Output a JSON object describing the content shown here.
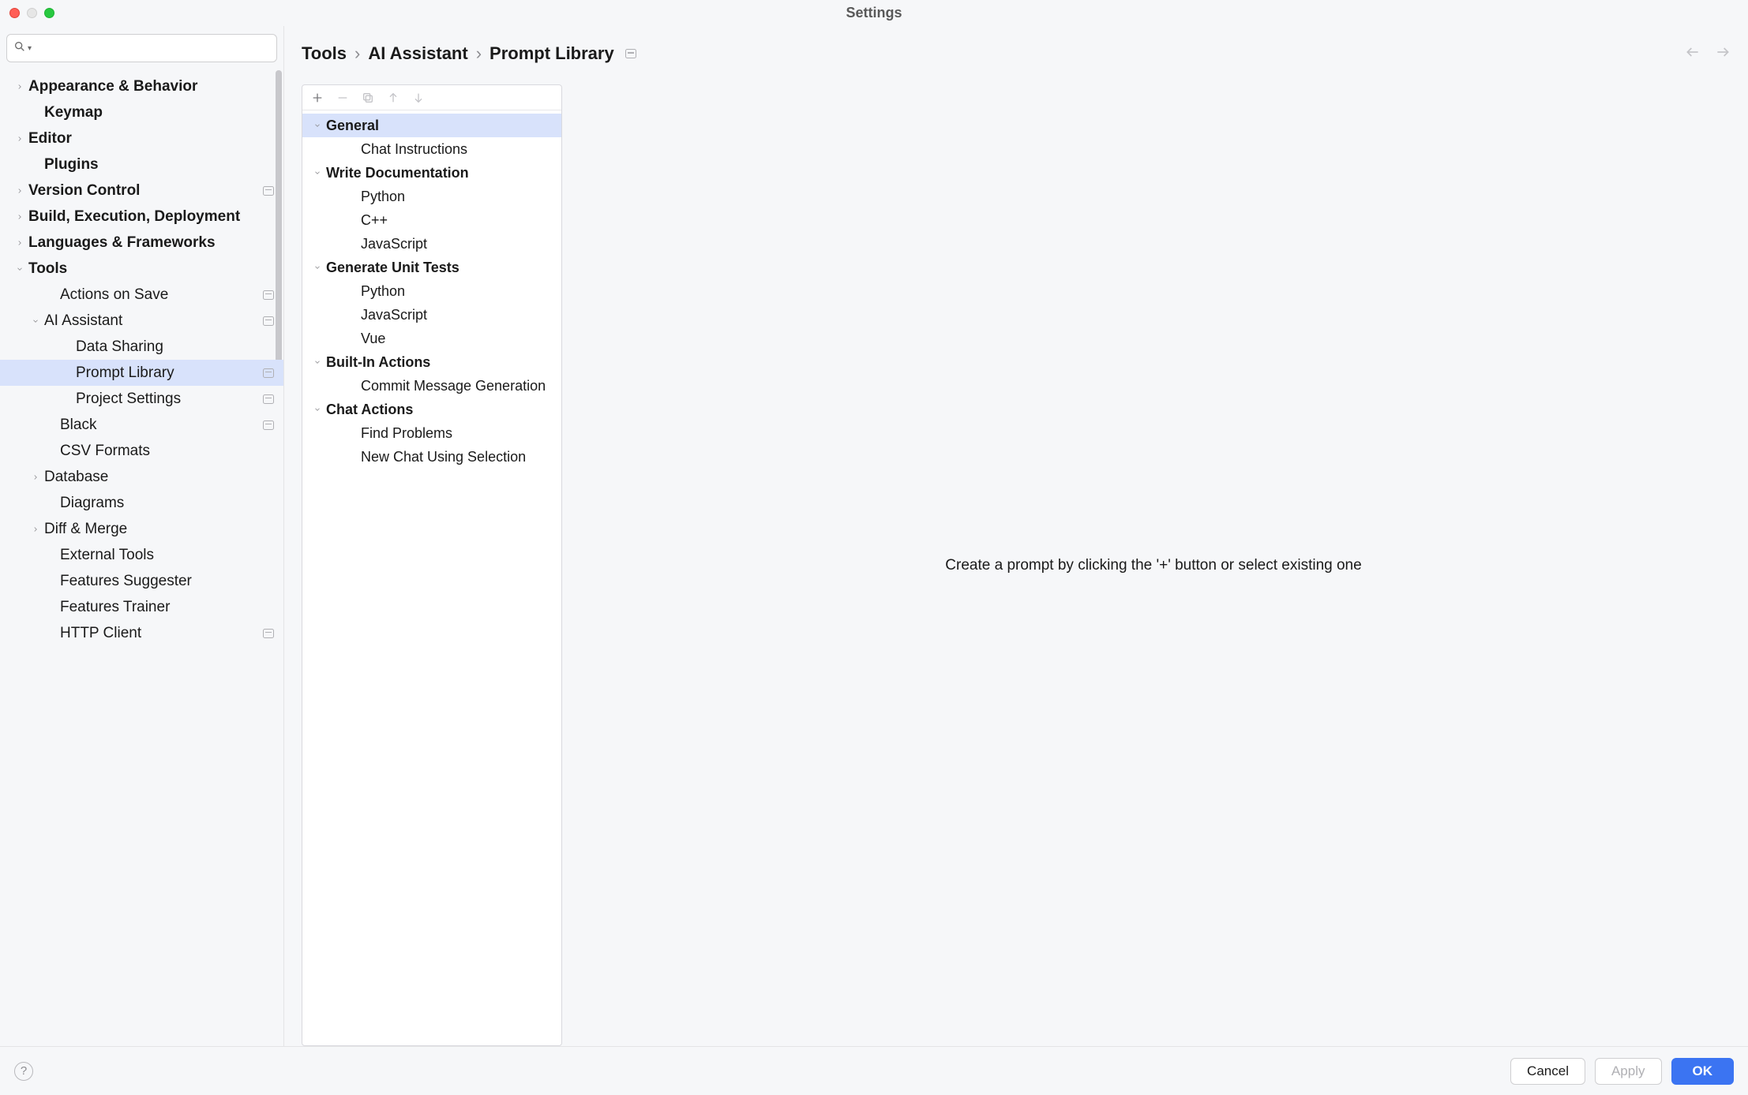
{
  "window": {
    "title": "Settings"
  },
  "search": {
    "placeholder": ""
  },
  "sidebar": {
    "items": [
      {
        "label": "Appearance & Behavior",
        "bold": true,
        "arrow": "right",
        "indent": 18,
        "badge": false
      },
      {
        "label": "Keymap",
        "bold": true,
        "arrow": "none",
        "indent": 38,
        "badge": false
      },
      {
        "label": "Editor",
        "bold": true,
        "arrow": "right",
        "indent": 18,
        "badge": false
      },
      {
        "label": "Plugins",
        "bold": true,
        "arrow": "none",
        "indent": 38,
        "badge": false
      },
      {
        "label": "Version Control",
        "bold": true,
        "arrow": "right",
        "indent": 18,
        "badge": true
      },
      {
        "label": "Build, Execution, Deployment",
        "bold": true,
        "arrow": "right",
        "indent": 18,
        "badge": false
      },
      {
        "label": "Languages & Frameworks",
        "bold": true,
        "arrow": "right",
        "indent": 18,
        "badge": false
      },
      {
        "label": "Tools",
        "bold": true,
        "arrow": "down",
        "indent": 18,
        "badge": false
      },
      {
        "label": "Actions on Save",
        "bold": false,
        "arrow": "none",
        "indent": 58,
        "badge": true
      },
      {
        "label": "AI Assistant",
        "bold": false,
        "arrow": "down",
        "indent": 38,
        "badge": true
      },
      {
        "label": "Data Sharing",
        "bold": false,
        "arrow": "none",
        "indent": 78,
        "badge": false
      },
      {
        "label": "Prompt Library",
        "bold": false,
        "arrow": "none",
        "indent": 78,
        "badge": true,
        "selected": true
      },
      {
        "label": "Project Settings",
        "bold": false,
        "arrow": "none",
        "indent": 78,
        "badge": true
      },
      {
        "label": "Black",
        "bold": false,
        "arrow": "none",
        "indent": 58,
        "badge": true
      },
      {
        "label": "CSV Formats",
        "bold": false,
        "arrow": "none",
        "indent": 58,
        "badge": false
      },
      {
        "label": "Database",
        "bold": false,
        "arrow": "right",
        "indent": 38,
        "badge": false
      },
      {
        "label": "Diagrams",
        "bold": false,
        "arrow": "none",
        "indent": 58,
        "badge": false
      },
      {
        "label": "Diff & Merge",
        "bold": false,
        "arrow": "right",
        "indent": 38,
        "badge": false
      },
      {
        "label": "External Tools",
        "bold": false,
        "arrow": "none",
        "indent": 58,
        "badge": false
      },
      {
        "label": "Features Suggester",
        "bold": false,
        "arrow": "none",
        "indent": 58,
        "badge": false
      },
      {
        "label": "Features Trainer",
        "bold": false,
        "arrow": "none",
        "indent": 58,
        "badge": false
      },
      {
        "label": "HTTP Client",
        "bold": false,
        "arrow": "none",
        "indent": 58,
        "badge": true
      }
    ]
  },
  "breadcrumb": {
    "parts": [
      "Tools",
      "AI Assistant",
      "Prompt Library"
    ]
  },
  "promptTree": [
    {
      "label": "General",
      "bold": true,
      "arrow": "down",
      "indent": 12,
      "selected": true
    },
    {
      "label": "Chat Instructions",
      "bold": false,
      "arrow": "none",
      "indent": 56
    },
    {
      "label": "Write Documentation",
      "bold": true,
      "arrow": "down",
      "indent": 12
    },
    {
      "label": "Python",
      "bold": false,
      "arrow": "none",
      "indent": 56
    },
    {
      "label": "C++",
      "bold": false,
      "arrow": "none",
      "indent": 56
    },
    {
      "label": "JavaScript",
      "bold": false,
      "arrow": "none",
      "indent": 56
    },
    {
      "label": "Generate Unit Tests",
      "bold": true,
      "arrow": "down",
      "indent": 12
    },
    {
      "label": "Python",
      "bold": false,
      "arrow": "none",
      "indent": 56
    },
    {
      "label": "JavaScript",
      "bold": false,
      "arrow": "none",
      "indent": 56
    },
    {
      "label": "Vue",
      "bold": false,
      "arrow": "none",
      "indent": 56
    },
    {
      "label": "Built-In Actions",
      "bold": true,
      "arrow": "down",
      "indent": 12
    },
    {
      "label": "Commit Message Generation",
      "bold": false,
      "arrow": "none",
      "indent": 56
    },
    {
      "label": "Chat Actions",
      "bold": true,
      "arrow": "down",
      "indent": 12
    },
    {
      "label": "Find Problems",
      "bold": false,
      "arrow": "none",
      "indent": 56
    },
    {
      "label": "New Chat Using Selection",
      "bold": false,
      "arrow": "none",
      "indent": 56
    }
  ],
  "detail": {
    "message": "Create a prompt by clicking the '+' button or select existing one"
  },
  "footer": {
    "cancel": "Cancel",
    "apply": "Apply",
    "ok": "OK"
  }
}
